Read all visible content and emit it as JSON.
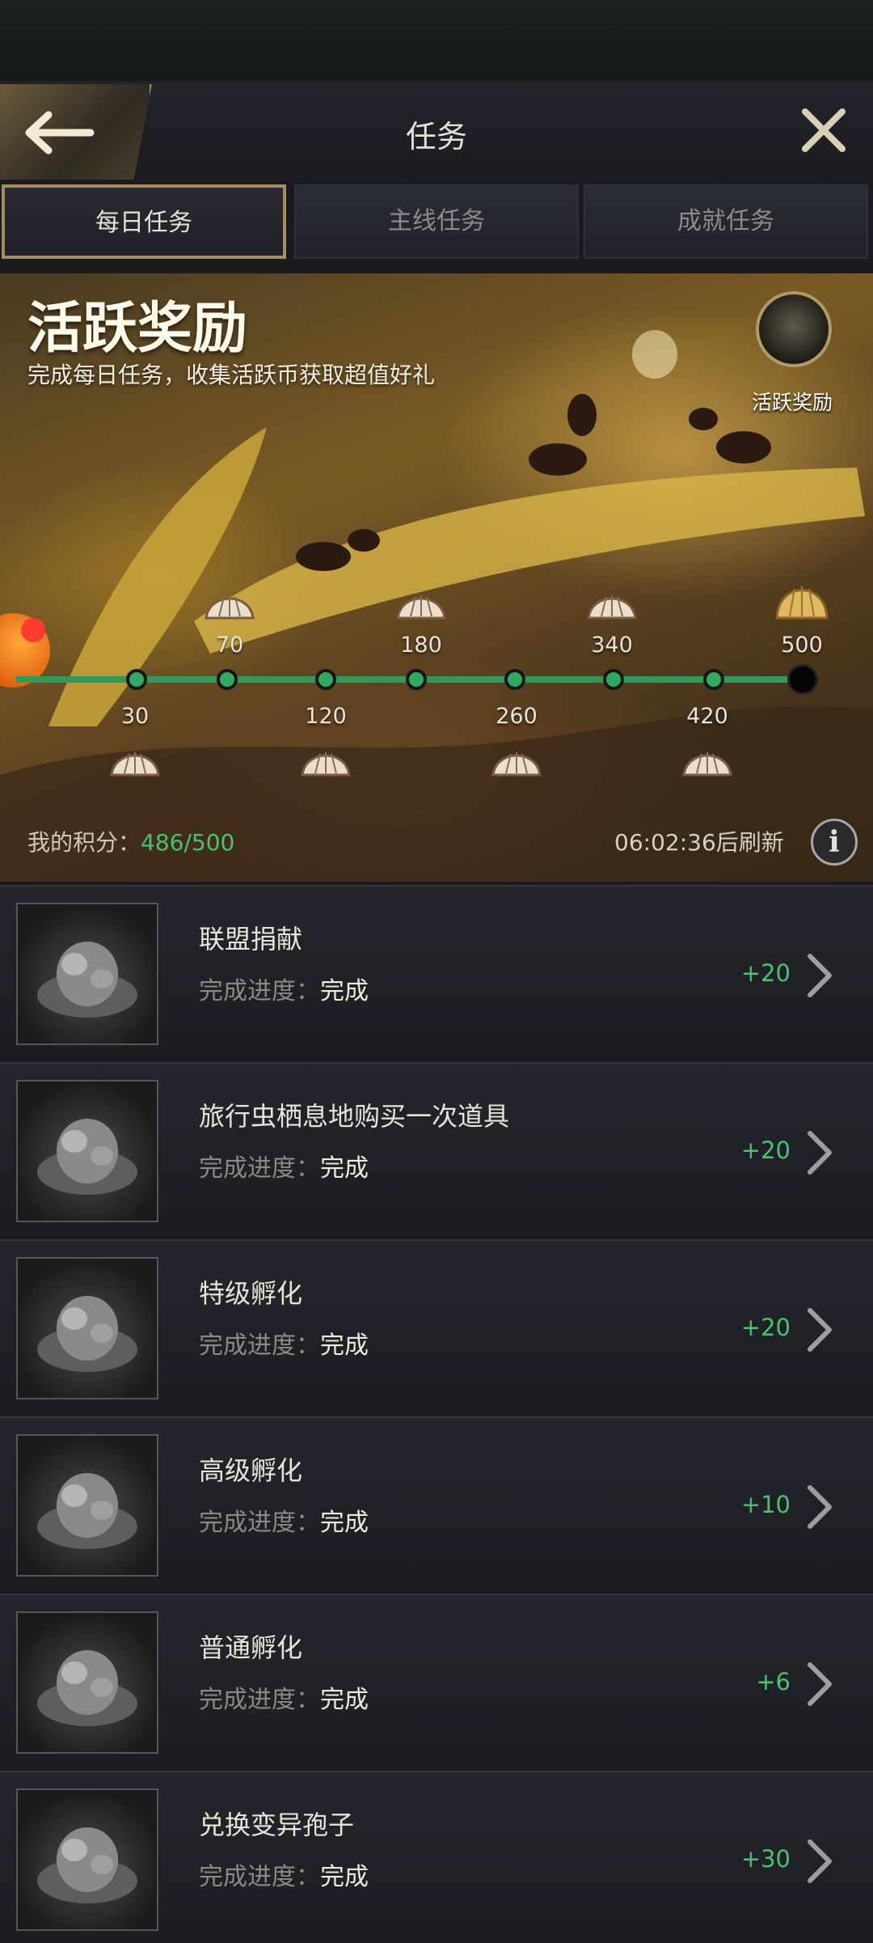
{
  "header": {
    "title": "任务"
  },
  "tabs": [
    {
      "label": "每日任务",
      "active": true
    },
    {
      "label": "主线任务",
      "active": false
    },
    {
      "label": "成就任务",
      "active": false
    }
  ],
  "banner": {
    "title": "活跃奖励",
    "subtitle": "完成每日任务，收集活跃币获取超值好礼",
    "badge_label": "活跃奖励",
    "milestones_top": [
      "70",
      "180",
      "340",
      "500"
    ],
    "milestones_bottom": [
      "30",
      "120",
      "260",
      "420"
    ],
    "score_label": "我的积分：",
    "score_value": "486/500",
    "refresh_text": "06:02:36后刷新",
    "info_glyph": "i"
  },
  "progress": {
    "current": 486,
    "max": 500
  },
  "tasks": [
    {
      "title": "联盟捐献",
      "progress_label": "完成进度：",
      "progress_value": "完成",
      "points": "+20",
      "icon": "alliance-donation-icon"
    },
    {
      "title": "旅行虫栖息地购买一次道具",
      "progress_label": "完成进度：",
      "progress_value": "完成",
      "points": "+20",
      "icon": "mushroom-habitat-icon"
    },
    {
      "title": "特级孵化",
      "progress_label": "完成进度：",
      "progress_value": "完成",
      "points": "+20",
      "icon": "hatchery-icon"
    },
    {
      "title": "高级孵化",
      "progress_label": "完成进度：",
      "progress_value": "完成",
      "points": "+10",
      "icon": "hatchery-icon"
    },
    {
      "title": "普通孵化",
      "progress_label": "完成进度：",
      "progress_value": "完成",
      "points": "+6",
      "icon": "hatchery-icon"
    },
    {
      "title": "兑换变异孢子",
      "progress_label": "完成进度：",
      "progress_value": "完成",
      "points": "+30",
      "icon": "mutant-spore-icon"
    }
  ],
  "colors": {
    "accent_green": "#45c46e",
    "gold_border": "#a38d5c",
    "background": "#1b1b1f"
  }
}
